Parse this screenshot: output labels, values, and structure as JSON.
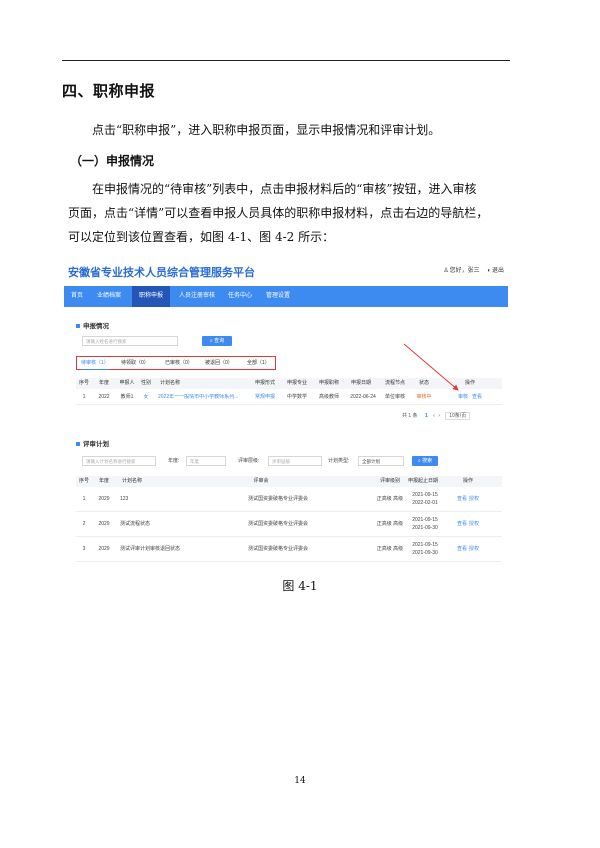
{
  "section_title": "四、职称申报",
  "intro": "点击“职称申报”，进入职称申报页面，显示申报情况和评审计划。",
  "subsection_title": "（一）申报情况",
  "body_lines": [
    "在申报情况的“待审核”列表中，点击申报材料后的“审核”按钮，进入审核",
    "页面，点击“详情”可以查看申报人员具体的职称申报材料，点击右边的导航栏，",
    "可以定位到该位置查看，如图 4-1、图 4-2 所示："
  ],
  "screenshot": {
    "brand": "安徽省专业技术人员综合管理服务平台",
    "user_greeting": "您好，张三",
    "logout": "退出",
    "nav": [
      "首页",
      "业绩档案",
      "职称申报",
      "人员注册审核",
      "任务中心",
      "管理设置"
    ],
    "panel1": {
      "title": "申报情况",
      "search_placeholder": "请输入姓名进行搜索",
      "search_button": "查询",
      "tabs": [
        "待审核（1）",
        "待领取（0）",
        "已审核（0）",
        "被退回（0）",
        "全部（1）"
      ],
      "columns": [
        "序号",
        "年度",
        "申报人",
        "性别",
        "计划名称",
        "申报形式",
        "申报专业",
        "申报职称",
        "申报日期",
        "流程节点",
        "状态",
        "操作"
      ],
      "rows": [
        {
          "no": "1",
          "year": "2022",
          "name": "教师1",
          "gender": "女",
          "plan": "2022年一一般情市中小学教师系列...",
          "form": "常规申报",
          "major": "中学数学",
          "title": "高级教师",
          "date": "2022-06-24",
          "node": "单位审核",
          "status": "审核中",
          "ops": [
            "审核",
            "查看"
          ]
        }
      ],
      "pager": {
        "total": "共 1 条",
        "page": "1",
        "size": "10条/页"
      }
    },
    "panel2": {
      "title": "评审计划",
      "search_placeholder": "请输入计划名称进行搜索",
      "year_label": "年度:",
      "year_placeholder": "年度",
      "level_label": "评审层级:",
      "level_placeholder": "评审层级",
      "type_label": "计划类型:",
      "type_value": "全部计划",
      "search_button": "搜索",
      "columns": [
        "序号",
        "年度",
        "计划名称",
        "评审会",
        "评审级别",
        "申报起止日期",
        "操作"
      ],
      "rows": [
        {
          "no": "1",
          "year": "2029",
          "plan": "123",
          "committee": "测试国资委破格专业评委会",
          "level": "正高级 高级",
          "dates": [
            "2021-09-15",
            "2022-02-01"
          ],
          "ops": [
            "查看",
            "授权"
          ]
        },
        {
          "no": "2",
          "year": "2029",
          "plan": "测试流程状态",
          "committee": "测试国资委破格专业评委会",
          "level": "正高级 高级",
          "dates": [
            "2021-09-15",
            "2021-09-30"
          ],
          "ops": [
            "查看",
            "授权"
          ]
        },
        {
          "no": "3",
          "year": "2029",
          "plan": "测试评审计划审核退回状态",
          "committee": "测试国资委破格专业评委会",
          "level": "正高级 高级",
          "dates": [
            "2021-09-15",
            "2021-09-30"
          ],
          "ops": [
            "查看",
            "授权"
          ]
        }
      ]
    },
    "colors": {
      "primary": "#3d8af0",
      "nav_active": "#2456b8",
      "highlight": "#e03b3b",
      "status": "#e06b2e"
    }
  },
  "figure_caption": "图 4-1",
  "page_number": "14"
}
